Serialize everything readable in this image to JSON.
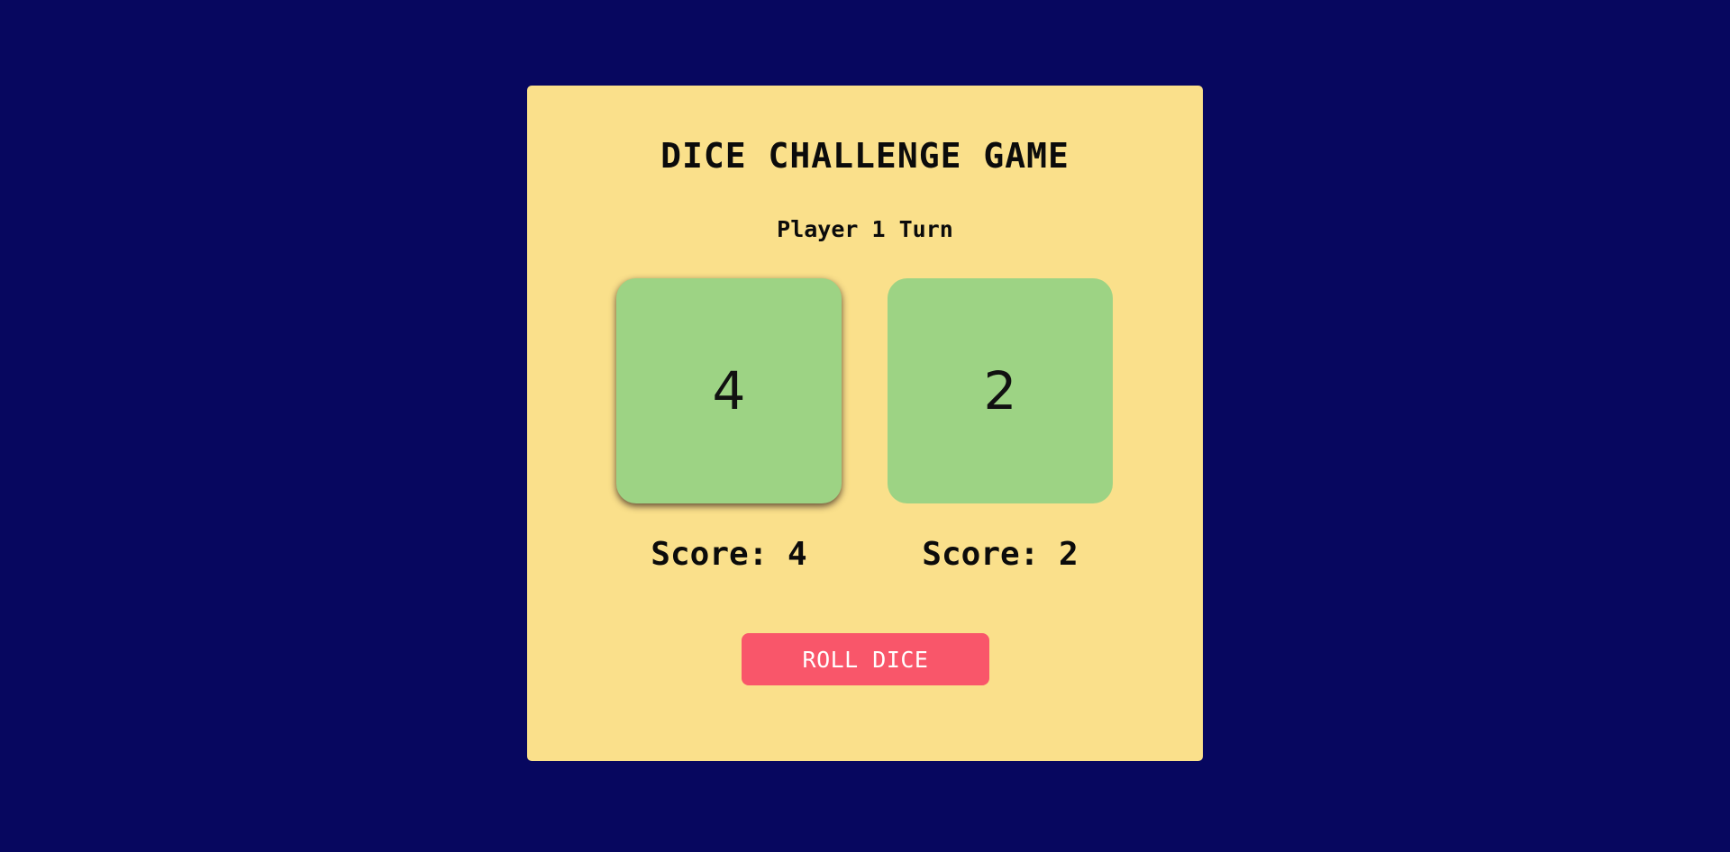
{
  "game": {
    "title": "DICE CHALLENGE GAME",
    "turn_text": "Player 1 Turn",
    "active_player": 1,
    "dice": [
      {
        "value": "4",
        "score_text": "Score: 4"
      },
      {
        "value": "2",
        "score_text": "Score: 2"
      }
    ],
    "roll_button_label": "ROLL DICE"
  },
  "colors": {
    "background": "#07075f",
    "card": "#fae08b",
    "die": "#9dd384",
    "button": "#f9566a",
    "button_text": "#ffffff"
  }
}
